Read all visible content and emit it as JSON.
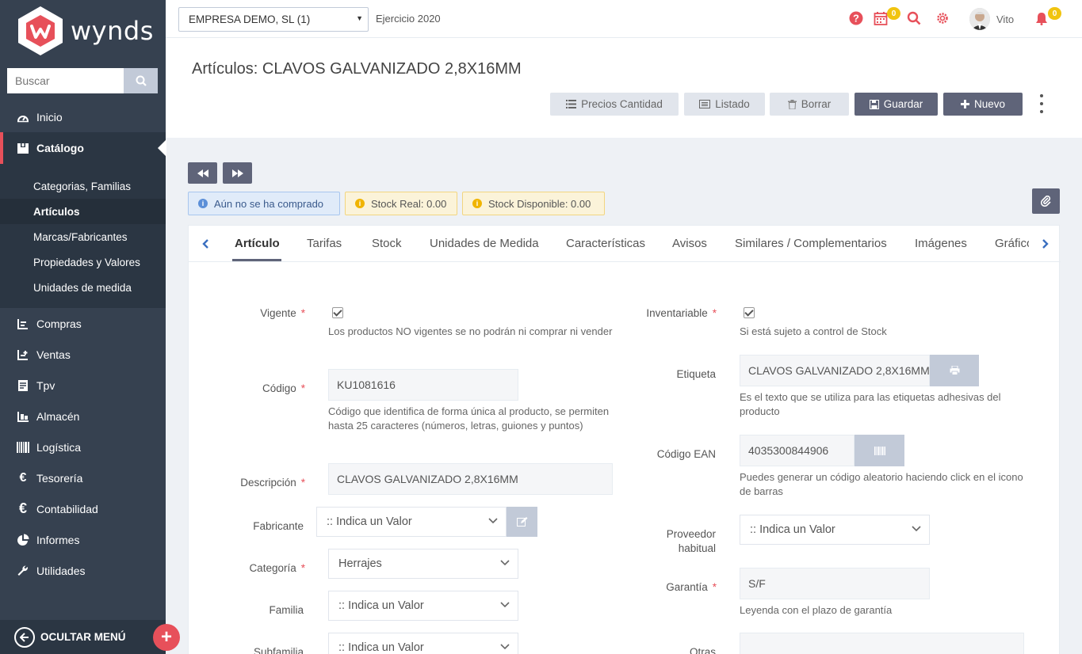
{
  "brand": {
    "name": "wynds",
    "accent": "#e7505a"
  },
  "sidebar": {
    "search_placeholder": "Buscar",
    "items_top": [
      {
        "label": "Inicio",
        "icon": "dashboard-icon"
      },
      {
        "label": "Catálogo",
        "icon": "catalog-box-icon",
        "active": true
      }
    ],
    "submenu": [
      {
        "label": "Categorias, Familias"
      },
      {
        "label": "Artículos",
        "active": true
      },
      {
        "label": "Marcas/Fabricantes"
      },
      {
        "label": "Propiedades y Valores"
      },
      {
        "label": "Unidades de medida"
      }
    ],
    "items_bottom": [
      {
        "label": "Compras",
        "icon": "purchases-icon"
      },
      {
        "label": "Ventas",
        "icon": "sales-icon"
      },
      {
        "label": "Tpv",
        "icon": "pos-icon"
      },
      {
        "label": "Almacén",
        "icon": "warehouse-icon"
      },
      {
        "label": "Logística",
        "icon": "barcode-icon"
      },
      {
        "label": "Tesorería",
        "icon": "euro-icon"
      },
      {
        "label": "Contabilidad",
        "icon": "euro-icon"
      },
      {
        "label": "Informes",
        "icon": "pie-chart-icon"
      },
      {
        "label": "Utilidades",
        "icon": "wrench-icon"
      }
    ],
    "hide_menu_label": "OCULTAR MENÚ"
  },
  "topbar": {
    "company": "EMPRESA DEMO, SL (1)",
    "ejercicio": "Ejercicio 2020",
    "calendar_count": "0",
    "notifications_count": "0",
    "user_name": "Vito"
  },
  "page": {
    "title": "Artículos: CLAVOS GALVANIZADO 2,8X16MM",
    "buttons": {
      "precios": "Precios Cantidad",
      "listado": "Listado",
      "borrar": "Borrar",
      "guardar": "Guardar",
      "nuevo": "Nuevo"
    }
  },
  "info": {
    "purchase": "Aún no se ha comprado",
    "stock_real": "Stock Real: 0.00",
    "stock_disponible": "Stock Disponible: 0.00"
  },
  "tabs": [
    "Artículo",
    "Tarifas",
    "Stock",
    "Unidades de Medida",
    "Características",
    "Avisos",
    "Similares / Complementarios",
    "Imágenes",
    "Gráficos"
  ],
  "form": {
    "vigente": {
      "label": "Vigente",
      "checked": true,
      "help": "Los productos NO vigentes se no podrán ni comprar ni vender"
    },
    "codigo": {
      "label": "Código",
      "value": "KU1081616",
      "help": "Código que identifica de forma única al producto, se permiten hasta 25 caracteres (números, letras, guiones y puntos)"
    },
    "descripcion": {
      "label": "Descripción",
      "value": "CLAVOS GALVANIZADO 2,8X16MM"
    },
    "fabricante": {
      "label": "Fabricante",
      "value": ":: Indica un Valor"
    },
    "categoria": {
      "label": "Categoría",
      "value": "Herrajes"
    },
    "familia": {
      "label": "Familia",
      "value": ":: Indica un Valor"
    },
    "subfamilia": {
      "label": "Subfamilia",
      "value": ":: Indica un Valor"
    },
    "inventariable": {
      "label": "Inventariable",
      "checked": true,
      "help": "Si está sujeto a control de Stock"
    },
    "etiqueta": {
      "label": "Etiqueta",
      "value": "CLAVOS GALVANIZADO 2,8X16MM",
      "help": "Es el texto que se utiliza para las etiquetas adhesivas del producto"
    },
    "ean": {
      "label": "Código EAN",
      "value": "4035300844906",
      "help": "Puedes generar un código aleatorio haciendo click en el icono de barras"
    },
    "proveedor": {
      "label_line1": "Proveedor",
      "label_line2": "habitual",
      "value": ":: Indica un Valor"
    },
    "garantia": {
      "label": "Garantía",
      "value": "S/F",
      "help": "Leyenda con el plazo de garantía"
    },
    "otras": {
      "label": "Otras"
    }
  }
}
